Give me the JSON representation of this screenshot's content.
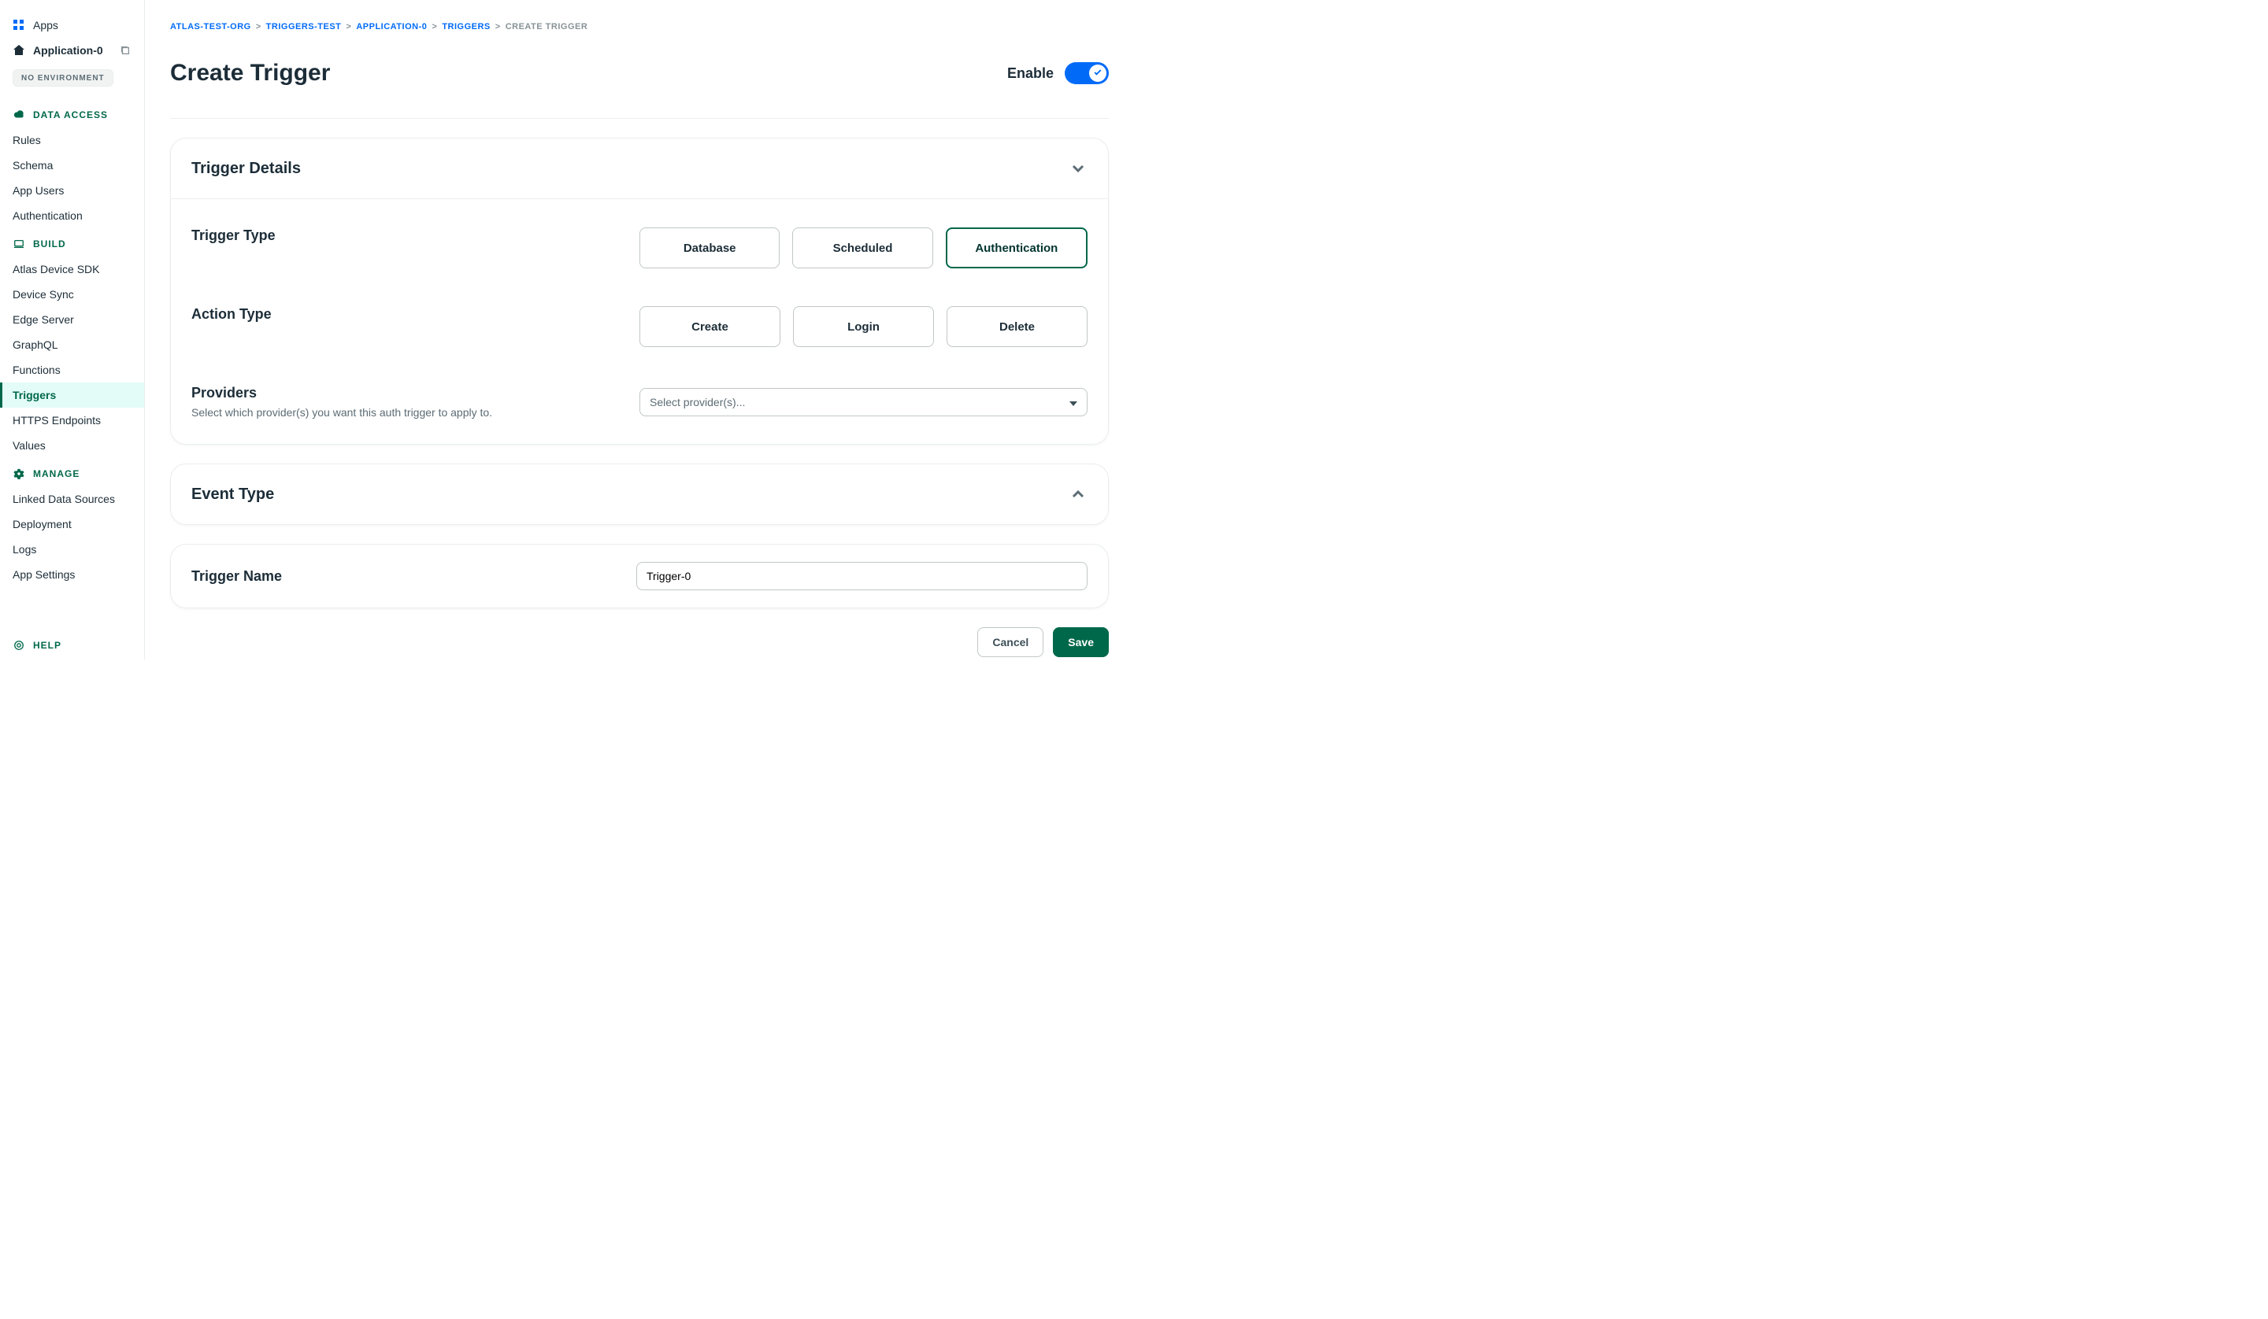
{
  "sidebar": {
    "apps_label": "Apps",
    "app_name": "Application-0",
    "env_badge": "NO ENVIRONMENT",
    "sections": {
      "data_access": {
        "title": "DATA ACCESS",
        "items": [
          "Rules",
          "Schema",
          "App Users",
          "Authentication"
        ]
      },
      "build": {
        "title": "BUILD",
        "items": [
          "Atlas Device SDK",
          "Device Sync",
          "Edge Server",
          "GraphQL",
          "Functions",
          "Triggers",
          "HTTPS Endpoints",
          "Values"
        ],
        "active_index": 5
      },
      "manage": {
        "title": "MANAGE",
        "items": [
          "Linked Data Sources",
          "Deployment",
          "Logs",
          "App Settings"
        ]
      }
    },
    "help_label": "HELP"
  },
  "breadcrumbs": {
    "items": [
      "ATLAS-TEST-ORG",
      "TRIGGERS-TEST",
      "APPLICATION-0",
      "TRIGGERS"
    ],
    "current": "CREATE TRIGGER",
    "separator": ">"
  },
  "page": {
    "title": "Create Trigger",
    "enable_label": "Enable",
    "enable_on": true
  },
  "details_card": {
    "title": "Trigger Details",
    "trigger_type": {
      "label": "Trigger Type",
      "options": [
        "Database",
        "Scheduled",
        "Authentication"
      ],
      "selected_index": 2
    },
    "action_type": {
      "label": "Action Type",
      "options": [
        "Create",
        "Login",
        "Delete"
      ],
      "selected_index": -1
    },
    "providers": {
      "label": "Providers",
      "description": "Select which provider(s) you want this auth trigger to apply to.",
      "placeholder": "Select provider(s)..."
    }
  },
  "event_card": {
    "title": "Event Type"
  },
  "name_card": {
    "label": "Trigger Name",
    "value": "Trigger-0"
  },
  "footer": {
    "cancel": "Cancel",
    "save": "Save"
  }
}
